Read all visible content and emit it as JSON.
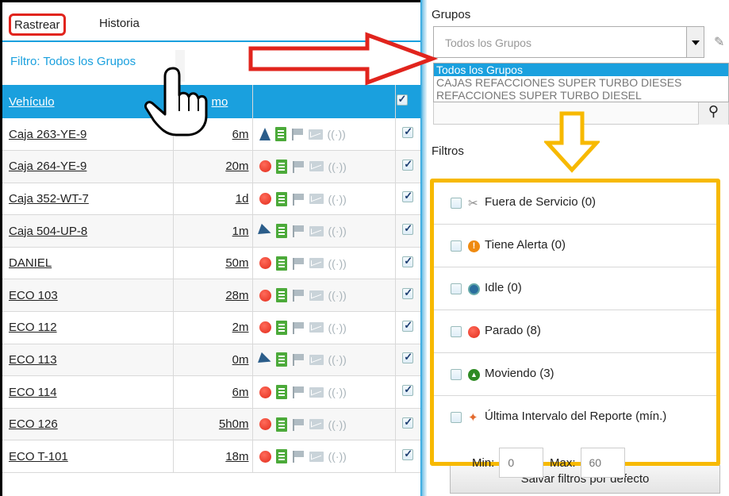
{
  "tabs": {
    "rastrear": "Rastrear",
    "historia": "Historia"
  },
  "filter_label": "Filtro: Todos los Grupos",
  "table": {
    "col_vehicle": "Vehículo",
    "col_time": "mo",
    "rows": [
      {
        "name": "Caja 263-YE-9",
        "time": "6m",
        "state": "nav-arrow"
      },
      {
        "name": "Caja 264-YE-9",
        "time": "20m",
        "state": "stopped"
      },
      {
        "name": "Caja 352-WT-7",
        "time": "1d",
        "state": "stopped"
      },
      {
        "name": "Caja 504-UP-8",
        "time": "1m",
        "state": "nav-arrow-right"
      },
      {
        "name": "DANIEL",
        "time": "50m",
        "state": "stopped"
      },
      {
        "name": "ECO 103",
        "time": "28m",
        "state": "stopped"
      },
      {
        "name": "ECO 112",
        "time": "2m",
        "state": "stopped"
      },
      {
        "name": "ECO 113",
        "time": "0m",
        "state": "nav-arrow-right"
      },
      {
        "name": "ECO 114",
        "time": "6m",
        "state": "stopped"
      },
      {
        "name": "ECO 126",
        "time": "5h0m",
        "state": "stopped"
      },
      {
        "name": "ECO T-101",
        "time": "18m",
        "state": "stopped"
      }
    ]
  },
  "grupos": {
    "title": "Grupos",
    "selected": "Todos los Grupos",
    "options": [
      "Todos los Grupos",
      "CAJAS REFACCIONES SUPER TURBO DIESES",
      "REFACCIONES SUPER TURBO DIESEL"
    ]
  },
  "filtros": {
    "title": "Filtros",
    "items": [
      {
        "label": "Fuera de Servicio (0)",
        "icon": "wrench-icon"
      },
      {
        "label": "Tiene Alerta (0)",
        "icon": "alert-icon"
      },
      {
        "label": "Idle (0)",
        "icon": "idle-icon"
      },
      {
        "label": "Parado (8)",
        "icon": "stopped-icon"
      },
      {
        "label": "Moviendo (3)",
        "icon": "moving-icon"
      },
      {
        "label": "Última Intervalo del Reporte (mín.)",
        "icon": "pin-icon"
      }
    ],
    "min_label": "Min:",
    "max_label": "Max:",
    "min_placeholder": "0",
    "max_placeholder": "60"
  },
  "save_button": "Salvar filtros por defecto",
  "colors": {
    "accent": "#1aa0de",
    "highlight_red": "#e1241d",
    "highlight_orange": "#f7b900"
  }
}
